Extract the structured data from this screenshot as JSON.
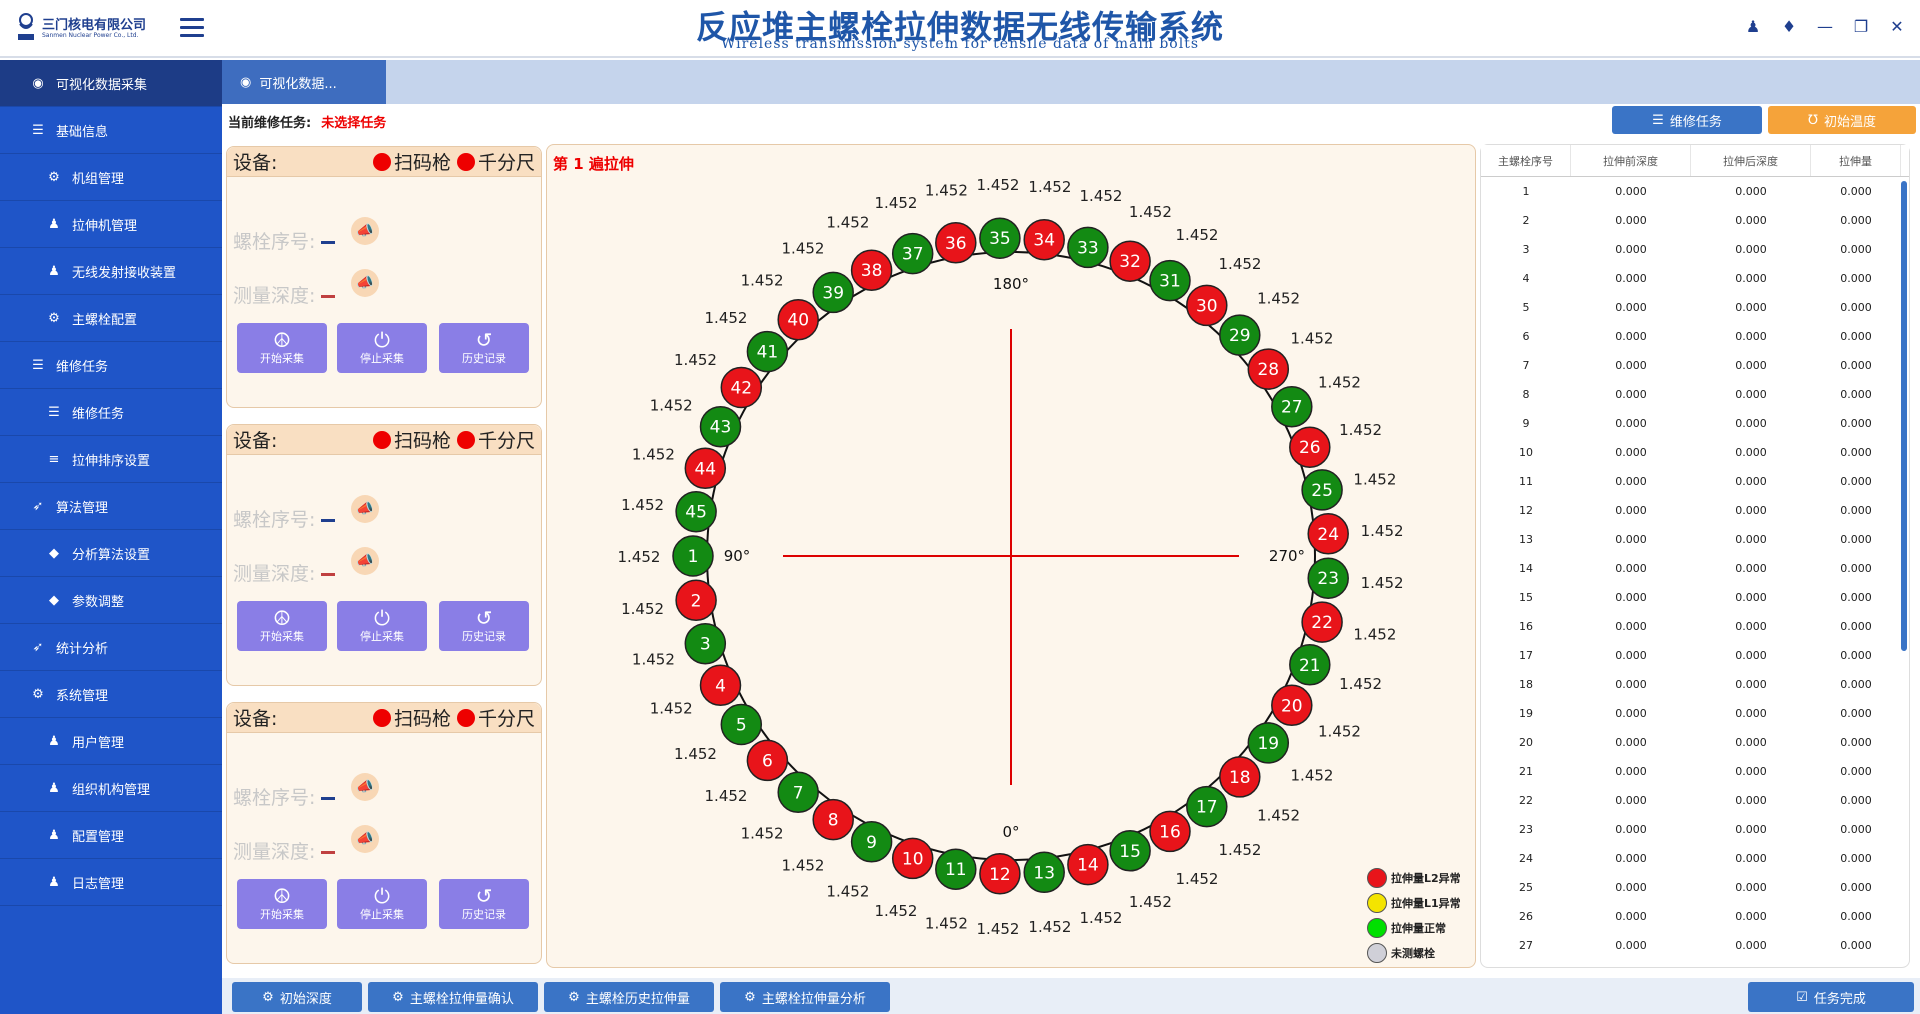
{
  "logo": {
    "cn": "三门核电有限公司",
    "en": "Sanmen Nuclear Power Co., Ltd."
  },
  "header": {
    "title": "反应堆主螺栓拉伸数据无线传输系统",
    "subtitle": "Wireless transmission system for tensile data of main bolts"
  },
  "sidebar": {
    "items": [
      {
        "label": "可视化数据采集",
        "icon": "dashboard-icon",
        "level": "top"
      },
      {
        "label": "基础信息",
        "icon": "database-icon",
        "level": "l1"
      },
      {
        "label": "机组管理",
        "icon": "gear-icon",
        "level": "l2"
      },
      {
        "label": "拉伸机管理",
        "icon": "users-icon",
        "level": "l2"
      },
      {
        "label": "无线发射接收装置",
        "icon": "users-icon",
        "level": "l2"
      },
      {
        "label": "主螺栓配置",
        "icon": "gear-outline-icon",
        "level": "l2"
      },
      {
        "label": "维修任务",
        "icon": "list-icon",
        "level": "l1"
      },
      {
        "label": "维修任务",
        "icon": "list-icon",
        "level": "l2"
      },
      {
        "label": "拉伸排序设置",
        "icon": "sort-icon",
        "level": "l2"
      },
      {
        "label": "算法管理",
        "icon": "rocket-icon",
        "level": "l1"
      },
      {
        "label": "分析算法设置",
        "icon": "tag-icon",
        "level": "l2"
      },
      {
        "label": "参数调整",
        "icon": "tag-icon",
        "level": "l2"
      },
      {
        "label": "统计分析",
        "icon": "rocket-icon",
        "level": "l1"
      },
      {
        "label": "系统管理",
        "icon": "cogs-icon",
        "level": "l1"
      },
      {
        "label": "用户管理",
        "icon": "user-icon",
        "level": "l2"
      },
      {
        "label": "组织机构管理",
        "icon": "user-icon",
        "level": "l2"
      },
      {
        "label": "配置管理",
        "icon": "user-icon",
        "level": "l2"
      },
      {
        "label": "日志管理",
        "icon": "user-icon",
        "level": "l2"
      }
    ]
  },
  "tab": {
    "label": "可视化数据..."
  },
  "task": {
    "label": "当前维修任务:",
    "value": "未选择任务"
  },
  "top_buttons": {
    "repair": "维修任务",
    "temp": "初始温度"
  },
  "devices": [
    {
      "label": "设备:",
      "scanner": "扫码枪",
      "micrometer": "千分尺",
      "bolt_no": "螺栓序号:",
      "depth": "测量深度:",
      "start": "开始采集",
      "stop": "停止采集",
      "history": "历史记录"
    },
    {
      "label": "设备:",
      "scanner": "扫码枪",
      "micrometer": "千分尺",
      "bolt_no": "螺栓序号:",
      "depth": "测量深度:",
      "start": "开始采集",
      "stop": "停止采集",
      "history": "历史记录"
    },
    {
      "label": "设备:",
      "scanner": "扫码枪",
      "micrometer": "千分尺",
      "bolt_no": "螺栓序号:",
      "depth": "测量深度:",
      "start": "开始采集",
      "stop": "停止采集",
      "history": "历史记录"
    }
  ],
  "bolt_map": {
    "title": "第 1 遍拉伸",
    "angles": {
      "top": "180°",
      "left": "90°",
      "right": "270°",
      "bottom": "0°"
    },
    "value": "1.452",
    "count": 45,
    "red_bolts": [
      2,
      4,
      6,
      8,
      10,
      12,
      14,
      16,
      18,
      20,
      22,
      24,
      26,
      28,
      30,
      32,
      34,
      36,
      38,
      40,
      42,
      44
    ],
    "colors": {
      "red": "#e8141a",
      "green": "#138a13",
      "yellow": "#f4e400",
      "bright_green": "#00e000",
      "gray": "#d0d0d8"
    },
    "legend": [
      {
        "label": "拉伸量L2异常",
        "color": "#e8141a"
      },
      {
        "label": "拉伸量L1异常",
        "color": "#f4e400"
      },
      {
        "label": "拉伸量正常",
        "color": "#00e000"
      },
      {
        "label": "未测螺栓",
        "color": "#d0d0d8"
      }
    ]
  },
  "table": {
    "headers": [
      "主螺栓序号",
      "拉伸前深度",
      "拉伸后深度",
      "拉伸量"
    ],
    "rows": [
      [
        "1",
        "0.000",
        "0.000",
        "0.000"
      ],
      [
        "2",
        "0.000",
        "0.000",
        "0.000"
      ],
      [
        "3",
        "0.000",
        "0.000",
        "0.000"
      ],
      [
        "4",
        "0.000",
        "0.000",
        "0.000"
      ],
      [
        "5",
        "0.000",
        "0.000",
        "0.000"
      ],
      [
        "6",
        "0.000",
        "0.000",
        "0.000"
      ],
      [
        "7",
        "0.000",
        "0.000",
        "0.000"
      ],
      [
        "8",
        "0.000",
        "0.000",
        "0.000"
      ],
      [
        "9",
        "0.000",
        "0.000",
        "0.000"
      ],
      [
        "10",
        "0.000",
        "0.000",
        "0.000"
      ],
      [
        "11",
        "0.000",
        "0.000",
        "0.000"
      ],
      [
        "12",
        "0.000",
        "0.000",
        "0.000"
      ],
      [
        "13",
        "0.000",
        "0.000",
        "0.000"
      ],
      [
        "14",
        "0.000",
        "0.000",
        "0.000"
      ],
      [
        "15",
        "0.000",
        "0.000",
        "0.000"
      ],
      [
        "16",
        "0.000",
        "0.000",
        "0.000"
      ],
      [
        "17",
        "0.000",
        "0.000",
        "0.000"
      ],
      [
        "18",
        "0.000",
        "0.000",
        "0.000"
      ],
      [
        "19",
        "0.000",
        "0.000",
        "0.000"
      ],
      [
        "20",
        "0.000",
        "0.000",
        "0.000"
      ],
      [
        "21",
        "0.000",
        "0.000",
        "0.000"
      ],
      [
        "22",
        "0.000",
        "0.000",
        "0.000"
      ],
      [
        "23",
        "0.000",
        "0.000",
        "0.000"
      ],
      [
        "24",
        "0.000",
        "0.000",
        "0.000"
      ],
      [
        "25",
        "0.000",
        "0.000",
        "0.000"
      ],
      [
        "26",
        "0.000",
        "0.000",
        "0.000"
      ],
      [
        "27",
        "0.000",
        "0.000",
        "0.000"
      ]
    ]
  },
  "bottom": {
    "init_depth": "初始深度",
    "confirm": "主螺栓拉伸量确认",
    "history": "主螺栓历史拉伸量",
    "analysis": "主螺栓拉伸量分析",
    "complete": "任务完成"
  }
}
